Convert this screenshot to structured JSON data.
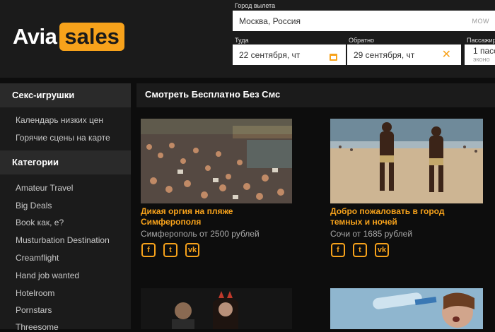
{
  "logo": {
    "part1": "Avia",
    "part2": "sales"
  },
  "search": {
    "origin_label": "Город вылета",
    "origin_value": "Москва, Россия",
    "origin_code": "MOW",
    "depart_label": "Туда",
    "depart_value": "22 сентября, чт",
    "return_label": "Обратно",
    "return_value": "29 сентября, чт",
    "passengers_label": "Пассажир",
    "passengers_value": "1 пасс",
    "passengers_class": "эконо"
  },
  "sidebar": {
    "section1_title": "Секс-игрушки",
    "section1_items": [
      "Календарь низких цен",
      "Горячие сцены на карте"
    ],
    "section2_title": "Категории",
    "section2_items": [
      "Amateur Travel",
      "Big Deals",
      "Book как, е?",
      "Musturbation Destination",
      "Creamflight",
      "Hand job wanted",
      "Hotelroom",
      "Pornstars",
      "Threesome"
    ]
  },
  "main": {
    "title": "Смотреть Бесплатно Без Смс",
    "cards": [
      {
        "title_line1": "Дикая оргия на пляже",
        "title_line2": "Симферополя",
        "subtitle": "Симферополь от 2500 рублей"
      },
      {
        "title_line1": "Добро пожаловать в город",
        "title_line2": "темных и ночей",
        "subtitle": "Сочи от 1685 рублей"
      }
    ]
  },
  "colors": {
    "accent": "#f7a21b",
    "background": "#0d0d0d",
    "panel": "#1b1b1b"
  },
  "icons": [
    "calendar-icon",
    "clear-icon",
    "facebook-icon",
    "twitter-icon",
    "vk-icon"
  ]
}
